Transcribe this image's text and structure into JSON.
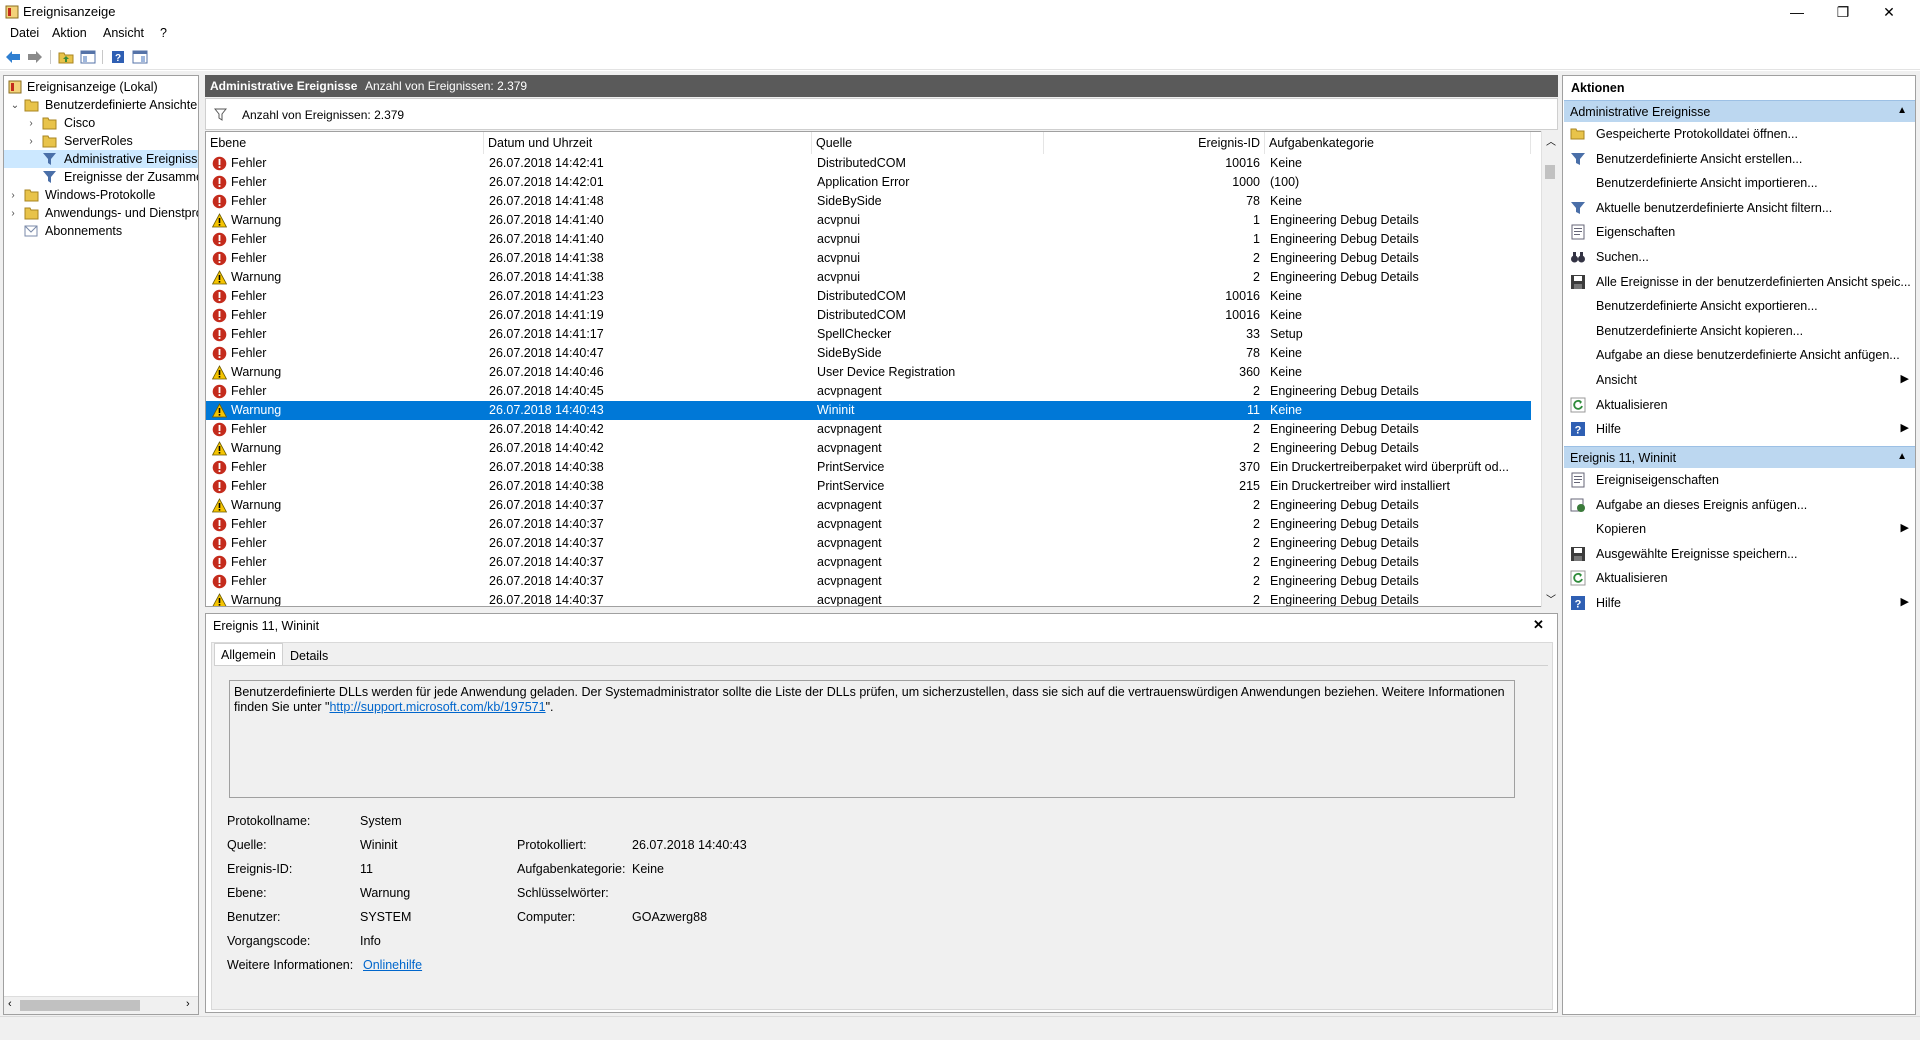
{
  "window": {
    "title": "Ereignisanzeige",
    "minimize": "—",
    "maximize": "❐",
    "close": "✕"
  },
  "menu": [
    "Datei",
    "Aktion",
    "Ansicht",
    "?"
  ],
  "tree": {
    "items": [
      {
        "label": "Ereignisanzeige (Lokal)"
      },
      {
        "label": "Benutzerdefinierte Ansichten"
      },
      {
        "label": "Cisco"
      },
      {
        "label": "ServerRoles"
      },
      {
        "label": "Administrative Ereignisse"
      },
      {
        "label": "Ereignisse der Zusammen"
      },
      {
        "label": "Windows-Protokolle"
      },
      {
        "label": "Anwendungs- und Dienstpro"
      },
      {
        "label": "Abonnements"
      }
    ]
  },
  "header": {
    "title": "Administrative Ereignisse",
    "count": "Anzahl von Ereignissen: 2.379"
  },
  "filter": {
    "text": "Anzahl von Ereignissen: 2.379"
  },
  "columns": {
    "level": "Ebene",
    "date": "Datum und Uhrzeit",
    "source": "Quelle",
    "id": "Ereignis-ID",
    "category": "Aufgabenkategorie"
  },
  "events": [
    {
      "level": "Fehler",
      "date": "26.07.2018 14:42:41",
      "source": "DistributedCOM",
      "id": "10016",
      "category": "Keine"
    },
    {
      "level": "Fehler",
      "date": "26.07.2018 14:42:01",
      "source": "Application Error",
      "id": "1000",
      "category": "(100)"
    },
    {
      "level": "Fehler",
      "date": "26.07.2018 14:41:48",
      "source": "SideBySide",
      "id": "78",
      "category": "Keine"
    },
    {
      "level": "Warnung",
      "date": "26.07.2018 14:41:40",
      "source": "acvpnui",
      "id": "1",
      "category": "Engineering Debug Details"
    },
    {
      "level": "Fehler",
      "date": "26.07.2018 14:41:40",
      "source": "acvpnui",
      "id": "1",
      "category": "Engineering Debug Details"
    },
    {
      "level": "Fehler",
      "date": "26.07.2018 14:41:38",
      "source": "acvpnui",
      "id": "2",
      "category": "Engineering Debug Details"
    },
    {
      "level": "Warnung",
      "date": "26.07.2018 14:41:38",
      "source": "acvpnui",
      "id": "2",
      "category": "Engineering Debug Details"
    },
    {
      "level": "Fehler",
      "date": "26.07.2018 14:41:23",
      "source": "DistributedCOM",
      "id": "10016",
      "category": "Keine"
    },
    {
      "level": "Fehler",
      "date": "26.07.2018 14:41:19",
      "source": "DistributedCOM",
      "id": "10016",
      "category": "Keine"
    },
    {
      "level": "Fehler",
      "date": "26.07.2018 14:41:17",
      "source": "SpellChecker",
      "id": "33",
      "category": "Setup"
    },
    {
      "level": "Fehler",
      "date": "26.07.2018 14:40:47",
      "source": "SideBySide",
      "id": "78",
      "category": "Keine"
    },
    {
      "level": "Warnung",
      "date": "26.07.2018 14:40:46",
      "source": "User Device Registration",
      "id": "360",
      "category": "Keine"
    },
    {
      "level": "Fehler",
      "date": "26.07.2018 14:40:45",
      "source": "acvpnagent",
      "id": "2",
      "category": "Engineering Debug Details"
    },
    {
      "level": "Warnung",
      "date": "26.07.2018 14:40:43",
      "source": "Wininit",
      "id": "11",
      "category": "Keine",
      "selected": true
    },
    {
      "level": "Fehler",
      "date": "26.07.2018 14:40:42",
      "source": "acvpnagent",
      "id": "2",
      "category": "Engineering Debug Details"
    },
    {
      "level": "Warnung",
      "date": "26.07.2018 14:40:42",
      "source": "acvpnagent",
      "id": "2",
      "category": "Engineering Debug Details"
    },
    {
      "level": "Fehler",
      "date": "26.07.2018 14:40:38",
      "source": "PrintService",
      "id": "370",
      "category": "Ein Druckertreiberpaket wird überprüft od..."
    },
    {
      "level": "Fehler",
      "date": "26.07.2018 14:40:38",
      "source": "PrintService",
      "id": "215",
      "category": "Ein Druckertreiber wird installiert"
    },
    {
      "level": "Warnung",
      "date": "26.07.2018 14:40:37",
      "source": "acvpnagent",
      "id": "2",
      "category": "Engineering Debug Details"
    },
    {
      "level": "Fehler",
      "date": "26.07.2018 14:40:37",
      "source": "acvpnagent",
      "id": "2",
      "category": "Engineering Debug Details"
    },
    {
      "level": "Fehler",
      "date": "26.07.2018 14:40:37",
      "source": "acvpnagent",
      "id": "2",
      "category": "Engineering Debug Details"
    },
    {
      "level": "Fehler",
      "date": "26.07.2018 14:40:37",
      "source": "acvpnagent",
      "id": "2",
      "category": "Engineering Debug Details"
    },
    {
      "level": "Fehler",
      "date": "26.07.2018 14:40:37",
      "source": "acvpnagent",
      "id": "2",
      "category": "Engineering Debug Details"
    },
    {
      "level": "Warnung",
      "date": "26.07.2018 14:40:37",
      "source": "acvpnagent",
      "id": "2",
      "category": "Engineering Debug Details"
    }
  ],
  "detail": {
    "title": "Ereignis 11, Wininit",
    "close": "✕",
    "tabs": [
      "Allgemein",
      "Details"
    ],
    "description_text": "Benutzerdefinierte DLLs werden für jede Anwendung geladen. Der Systemadministrator sollte die Liste der DLLs prüfen, um sicherzustellen, dass sie sich auf die vertrauenswürdigen Anwendungen beziehen. Weitere Informationen finden Sie unter \"",
    "description_link": "http://support.microsoft.com/kb/197571",
    "description_end": "\".",
    "fields": {
      "log_name_label": "Protokollname:",
      "log_name": "System",
      "source_label": "Quelle:",
      "source": "Wininit",
      "logged_label": "Protokolliert:",
      "logged": "26.07.2018 14:40:43",
      "event_id_label": "Ereignis-ID:",
      "event_id": "11",
      "task_label": "Aufgabenkategorie:",
      "task": "Keine",
      "level_label": "Ebene:",
      "level": "Warnung",
      "keywords_label": "Schlüsselwörter:",
      "keywords": "",
      "user_label": "Benutzer:",
      "user": "SYSTEM",
      "computer_label": "Computer:",
      "computer": "GOAzwerg88",
      "opcode_label": "Vorgangscode:",
      "opcode": "Info",
      "more_label": "Weitere Informationen:",
      "more_link": "Onlinehilfe"
    }
  },
  "actions": {
    "title": "Aktionen",
    "section1": "Administrative Ereignisse",
    "items1": [
      {
        "label": "Gespeicherte Protokolldatei öffnen...",
        "icon": "folder-open-icon"
      },
      {
        "label": "Benutzerdefinierte Ansicht erstellen...",
        "icon": "filter-icon"
      },
      {
        "label": "Benutzerdefinierte Ansicht importieren...",
        "icon": ""
      },
      {
        "label": "Aktuelle benutzerdefinierte Ansicht filtern...",
        "icon": "filter-icon"
      },
      {
        "label": "Eigenschaften",
        "icon": "properties-icon"
      },
      {
        "label": "Suchen...",
        "icon": "binoculars-icon"
      },
      {
        "label": "Alle Ereignisse in der benutzerdefinierten Ansicht speic...",
        "icon": "save-icon"
      },
      {
        "label": "Benutzerdefinierte Ansicht exportieren...",
        "icon": ""
      },
      {
        "label": "Benutzerdefinierte Ansicht kopieren...",
        "icon": ""
      },
      {
        "label": "Aufgabe an diese benutzerdefinierte Ansicht anfügen...",
        "icon": ""
      },
      {
        "label": "Ansicht",
        "icon": "",
        "submenu": true
      },
      {
        "label": "Aktualisieren",
        "icon": "refresh-icon"
      },
      {
        "label": "Hilfe",
        "icon": "help-icon",
        "submenu": true
      }
    ],
    "section2": "Ereignis 11, Wininit",
    "items2": [
      {
        "label": "Ereigniseigenschaften",
        "icon": "properties-icon"
      },
      {
        "label": "Aufgabe an dieses Ereignis anfügen...",
        "icon": "task-icon"
      },
      {
        "label": "Kopieren",
        "icon": "",
        "submenu": true
      },
      {
        "label": "Ausgewählte Ereignisse speichern...",
        "icon": "save-icon"
      },
      {
        "label": "Aktualisieren",
        "icon": "refresh-icon"
      },
      {
        "label": "Hilfe",
        "icon": "help-icon",
        "submenu": true
      }
    ]
  },
  "colors": {
    "selection": "#0078d7",
    "error": "#c42b1c",
    "warning": "#f5c400",
    "header_bar": "#5a5a5a",
    "action_section": "#bcd7f0"
  }
}
